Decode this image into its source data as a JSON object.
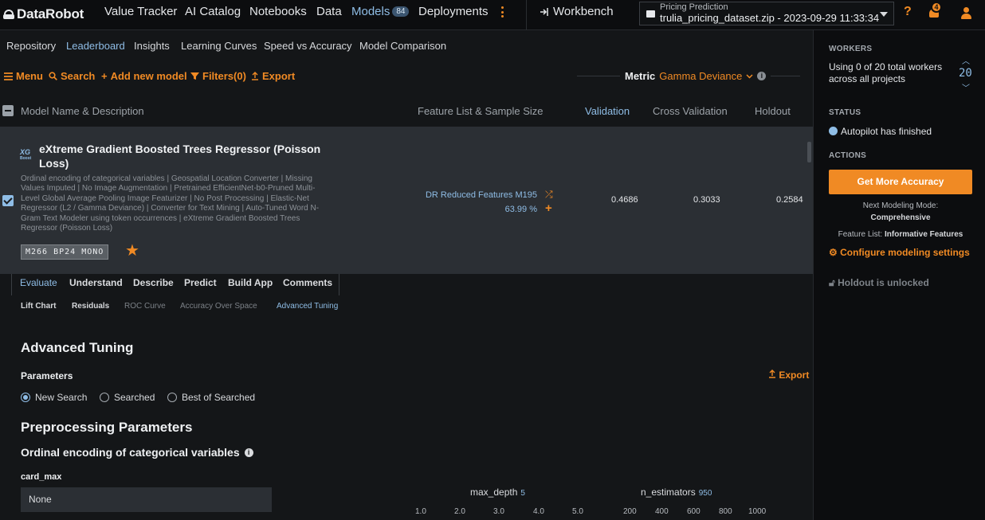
{
  "topnav": {
    "logo": "DataRobot",
    "items": [
      "Value Tracker",
      "AI Catalog",
      "Notebooks",
      "Data",
      "Models",
      "Deployments"
    ],
    "models_count": "84",
    "workbench": "Workbench",
    "project_name": "Pricing Prediction",
    "project_file": "trulia_pricing_dataset.zip - 2023-09-29 11:33:34",
    "help": "?",
    "notifications": "4"
  },
  "subnav": {
    "items": [
      "Repository",
      "Leaderboard",
      "Insights",
      "Learning Curves",
      "Speed vs Accuracy",
      "Model Comparison"
    ]
  },
  "toolbar": {
    "menu": "Menu",
    "search": "Search",
    "add_model": "Add new model",
    "filters": "Filters(0)",
    "export": "Export",
    "metric_label": "Metric",
    "metric_value": "Gamma Deviance"
  },
  "table": {
    "headers": [
      "Model Name & Description",
      "Feature List & Sample Size",
      "Validation",
      "Cross Validation",
      "Holdout"
    ]
  },
  "model": {
    "icon_text": "XG",
    "icon_sub": "Boost",
    "title": "eXtreme Gradient Boosted Trees Regressor (Poisson Loss)",
    "description": "Ordinal encoding of categorical variables | Geospatial Location Converter | Missing Values Imputed | No Image Augmentation | Pretrained EfficientNet-b0-Pruned Multi-Level Global Average Pooling Image Featurizer | No Post Processing | Elastic-Net Regressor (L2 / Gamma Deviance) | Converter for Text Mining | Auto-Tuned Word N-Gram Text Modeler using token occurrences | eXtreme Gradient Boosted Trees Regressor (Poisson Loss)",
    "tags": "M266  BP24  MONO",
    "feature_list": "DR Reduced Features M195",
    "sample_size": "63.99 %",
    "validation": "0.4686",
    "cross_validation": "0.3033",
    "holdout": "0.2584"
  },
  "detail_tabs": [
    "Evaluate",
    "Understand",
    "Describe",
    "Predict",
    "Build App",
    "Comments"
  ],
  "sub_tabs": [
    "Lift Chart",
    "Residuals",
    "ROC Curve",
    "Accuracy Over Space",
    "Advanced Tuning"
  ],
  "tuning": {
    "title": "Advanced Tuning",
    "parameters": "Parameters",
    "export": "Export",
    "radios": [
      "New Search",
      "Searched",
      "Best of Searched"
    ],
    "preprocessing": "Preprocessing Parameters",
    "section": "Ordinal encoding of categorical variables",
    "card_max_label": "card_max",
    "card_max_value": "None",
    "max_depth_label": "max_depth",
    "max_depth_value": "5",
    "n_estimators_label": "n_estimators",
    "n_estimators_value": "950",
    "max_depth_ticks": [
      "1.0",
      "2.0",
      "3.0",
      "4.0",
      "5.0"
    ],
    "n_estimators_ticks": [
      "200",
      "400",
      "600",
      "800",
      "1000"
    ]
  },
  "right_panel": {
    "workers_title": "WORKERS",
    "workers_text": "Using 0 of 20 total workers across all projects",
    "workers_count": "20",
    "status_title": "STATUS",
    "status_text": "Autopilot has finished",
    "actions_title": "ACTIONS",
    "get_more_accuracy": "Get More Accuracy",
    "next_mode_label": "Next Modeling Mode:",
    "next_mode_value": "Comprehensive",
    "feature_list_label": "Feature List:",
    "feature_list_value": "Informative Features",
    "configure": "Configure modeling settings",
    "holdout": "Holdout is unlocked"
  },
  "colors": {
    "accent": "#f08a24",
    "link": "#8fbde6",
    "background": "#141618"
  }
}
